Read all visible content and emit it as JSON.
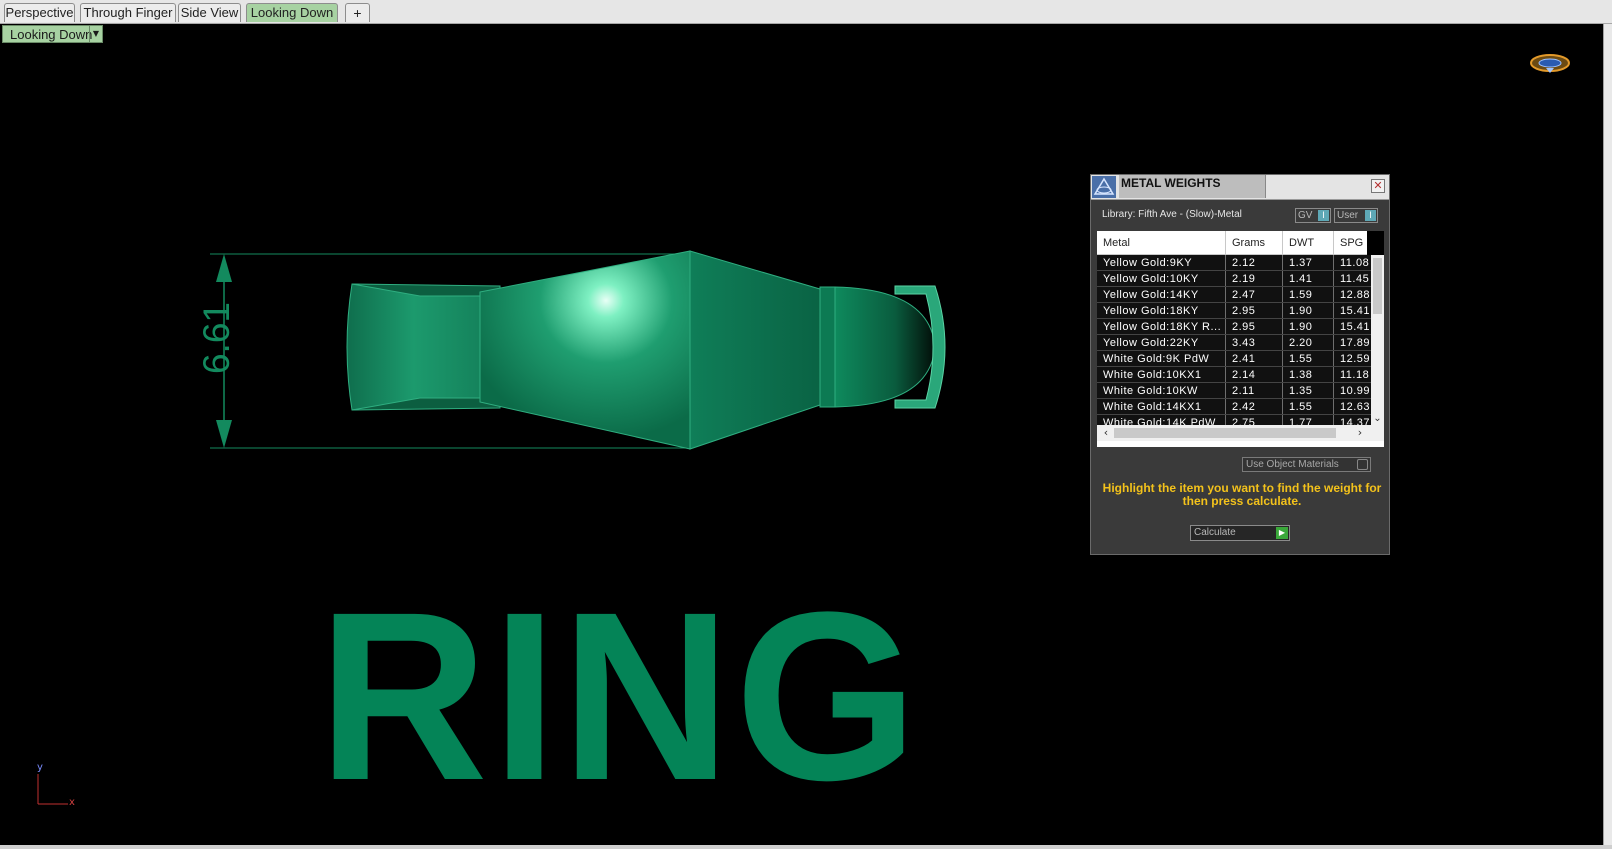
{
  "tabs": [
    {
      "label": "Perspective",
      "active": false
    },
    {
      "label": "Through Finger",
      "active": false
    },
    {
      "label": "Side View",
      "active": false
    },
    {
      "label": "Looking Down",
      "active": true
    }
  ],
  "add_tab_glyph": "+",
  "viewport": {
    "view_dropdown": "Looking Down",
    "dimension_value": "6.61",
    "caption": "RING",
    "axis": {
      "x": "x",
      "y": "y"
    }
  },
  "metal_weights": {
    "title": "METAL WEIGHTS",
    "library": "Library: Fifth Ave - (Slow)-Metal",
    "gv_button": "GV",
    "user_button": "User",
    "columns": [
      "Metal",
      "Grams",
      "DWT",
      "SPG"
    ],
    "rows": [
      [
        "Yellow Gold:9KY",
        "2.12",
        "1.37",
        "11.08"
      ],
      [
        "Yellow Gold:10KY",
        "2.19",
        "1.41",
        "11.45"
      ],
      [
        "Yellow Gold:14KY",
        "2.47",
        "1.59",
        "12.88"
      ],
      [
        "Yellow Gold:18KY",
        "2.95",
        "1.90",
        "15.41"
      ],
      [
        "Yellow Gold:18KY R...",
        "2.95",
        "1.90",
        "15.41"
      ],
      [
        "Yellow Gold:22KY",
        "3.43",
        "2.20",
        "17.89"
      ],
      [
        "White Gold:9K PdW",
        "2.41",
        "1.55",
        "12.59"
      ],
      [
        "White Gold:10KX1",
        "2.14",
        "1.38",
        "11.18"
      ],
      [
        "White Gold:10KW",
        "2.11",
        "1.35",
        "10.99"
      ],
      [
        "White Gold:14KX1",
        "2.42",
        "1.55",
        "12.63"
      ],
      [
        "White Gold:14K PdW",
        "2.75",
        "1.77",
        "14.37"
      ]
    ],
    "use_object_materials": "Use Object Materials",
    "hint": "Highlight the item you want to find the weight for then press calculate.",
    "calculate": "Calculate"
  },
  "colors": {
    "ring_green": "#048457",
    "tab_active": "#a7d2a2",
    "hint_yellow": "#f3c21b",
    "viewport_bg": "#000000"
  }
}
